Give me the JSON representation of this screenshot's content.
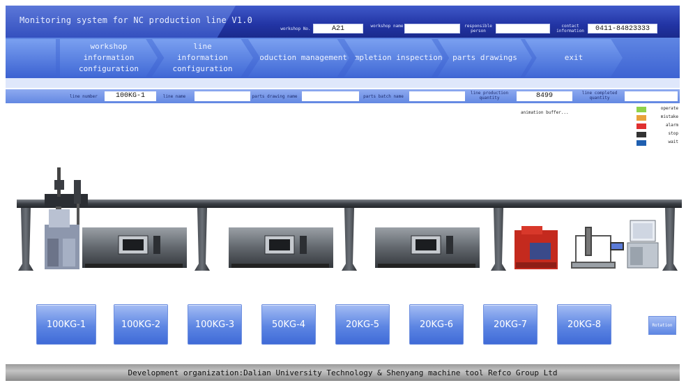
{
  "header": {
    "title": "Monitoring system for NC production line V1.0",
    "workshop_no_label": "workshop No.",
    "workshop_no": "A21",
    "workshop_name_label": "workshop name",
    "workshop_name": "",
    "responsible_label": "responsible person",
    "responsible": "",
    "contact_label": "contact information",
    "contact": "0411-84823333"
  },
  "nav": {
    "items": [
      {
        "label": "workshop information configuration"
      },
      {
        "label": "line information configuration"
      },
      {
        "label": "production management"
      },
      {
        "label": "completion inspection"
      },
      {
        "label": "parts drawings"
      },
      {
        "label": "exit"
      }
    ]
  },
  "line_info": {
    "line_number_label": "line number",
    "line_number": "100KG-1",
    "line_name_label": "line name",
    "line_name": "",
    "parts_drawing_name_label": "parts drawing name",
    "parts_drawing_name": "",
    "parts_batch_name_label": "parts batch name",
    "parts_batch_name": "",
    "production_quantity_label": "line production quantity",
    "production_quantity": "8499",
    "completed_quantity_label": "line completed quantity",
    "completed_quantity": ""
  },
  "status_text": "animation buffer...",
  "legend": [
    {
      "label": "operate",
      "color": "#8fd24a"
    },
    {
      "label": "mistake",
      "color": "#e8a23a"
    },
    {
      "label": "alarm",
      "color": "#e03030"
    },
    {
      "label": "stop",
      "color": "#333333"
    },
    {
      "label": "wait",
      "color": "#1f5fb0"
    }
  ],
  "lines": [
    "100KG-1",
    "100KG-2",
    "100KG-3",
    "50KG-4",
    "20KG-5",
    "20KG-6",
    "20KG-7",
    "20KG-8"
  ],
  "rotation_label": "Rotation",
  "footer": "Development organization:Dalian University Technology & Shenyang machine tool Refco Group Ltd"
}
